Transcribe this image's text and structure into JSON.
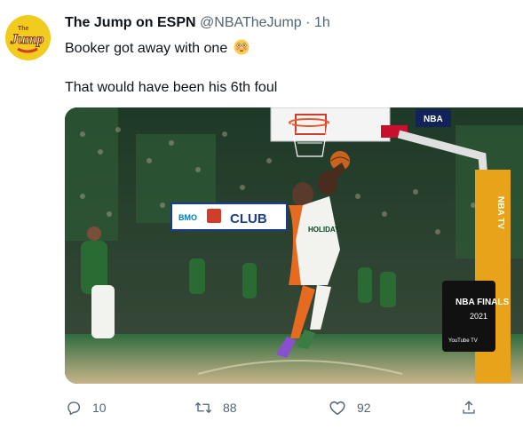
{
  "tweet": {
    "author_name": "The Jump on ESPN",
    "handle": "@NBATheJump",
    "separator": "·",
    "time": "1h",
    "text_line1": "Booker got away with one",
    "text_line2": "That would have been his 6th foul",
    "avatar_text": "Jump",
    "avatar_small_text": "The"
  },
  "media": {
    "club_sign": "CLUB",
    "bmo_sign": "BMO",
    "finals_logo": "NBA FINALS",
    "finals_year": "2021",
    "stanchion_text": "NBA TV",
    "bug": "NBA",
    "youtube_tag": "YouTube TV"
  },
  "actions": {
    "replies": "10",
    "retweets": "88",
    "likes": "92"
  },
  "colors": {
    "avatar_bg": "#f2cb1f",
    "stanchion": "#e8a31a",
    "bucks_green": "#00471b"
  },
  "icons": [
    "reply-icon",
    "retweet-icon",
    "like-icon",
    "share-icon",
    "flushed-face-emoji"
  ]
}
